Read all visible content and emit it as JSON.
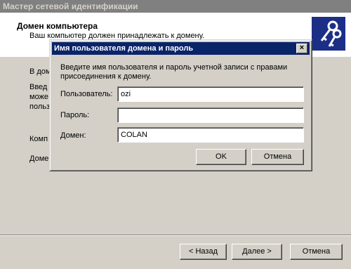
{
  "wizard": {
    "title": "Мастер сетевой идентификации",
    "header_title": "Домен компьютера",
    "header_subtitle": "Ваш компьютер должен принадлежать к домену.",
    "bg_lines": [
      "В дом",
      "Введ",
      "може",
      "польз",
      "Комп",
      "Доме"
    ],
    "back_label": "< Назад",
    "next_label": "Далее >",
    "cancel_label": "Отмена"
  },
  "dialog": {
    "title": "Имя пользователя домена и пароль",
    "instruction": "Введите имя пользователя и пароль учетной записи с правами присоединения к домену.",
    "user_label": "Пользователь:",
    "user_value": "ozi",
    "password_label": "Пароль:",
    "password_value": "",
    "domain_label": "Домен:",
    "domain_value": "COLAN",
    "ok_label": "OK",
    "cancel_label": "Отмена",
    "close_glyph": "×"
  },
  "colors": {
    "dialog_title_bg": "#0a246a",
    "face": "#d4d0c8"
  }
}
